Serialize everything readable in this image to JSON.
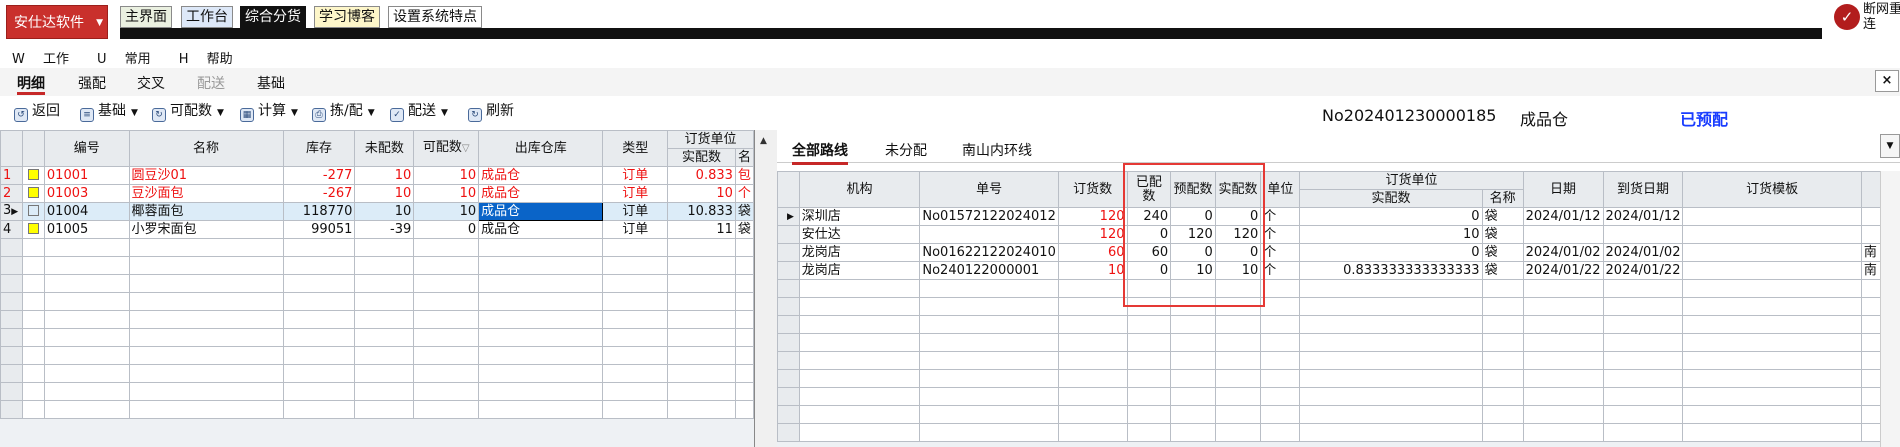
{
  "brand": {
    "label": "安仕达软件"
  },
  "top_tabs": [
    "主界面",
    "工作台",
    "综合分货",
    "学习博客",
    "设置系统特点"
  ],
  "connection": {
    "label_1": "断网重",
    "label_2": "连"
  },
  "menu": [
    {
      "key": "W",
      "label": "工作"
    },
    {
      "key": "U",
      "label": "常用"
    },
    {
      "key": "H",
      "label": "帮助"
    }
  ],
  "sub_tabs": [
    "明细",
    "强配",
    "交叉",
    "配送",
    "基础"
  ],
  "toolbar": {
    "back": "返回",
    "basic": "基础",
    "available": "可配数",
    "calc": "计算",
    "pick": "拣/配",
    "deliver": "配送",
    "refresh": "刷新"
  },
  "info": {
    "order_no": "No202401230000185",
    "warehouse": "成品仓",
    "status": "已预配"
  },
  "colors": {
    "brand": "#c9302c",
    "status": "#1a3dff",
    "highlight": "#e53935",
    "negative": "#e11111"
  },
  "left_table": {
    "headers": [
      "编号",
      "名称",
      "库存",
      "未配数",
      "可配数",
      "出库仓库",
      "类型",
      "订货单位",
      "实配数",
      "名"
    ],
    "rows": [
      {
        "idx": "1",
        "checked": true,
        "code": "01001",
        "name": "圆豆沙01",
        "stock": "-277",
        "unalloc": "10",
        "avail": "10",
        "wh": "成品仓",
        "type": "订单",
        "actual": "0.833",
        "unit": "包",
        "red": true,
        "selected": false
      },
      {
        "idx": "2",
        "checked": true,
        "code": "01003",
        "name": "豆沙面包",
        "stock": "-267",
        "unalloc": "10",
        "avail": "10",
        "wh": "成品仓",
        "type": "订单",
        "actual": "10",
        "unit": "个",
        "red": true,
        "selected": false
      },
      {
        "idx": "3",
        "checked": false,
        "code": "01004",
        "name": "椰蓉面包",
        "stock": "118770",
        "unalloc": "10",
        "avail": "10",
        "wh": "成品仓",
        "type": "订单",
        "actual": "10.833",
        "unit": "袋",
        "red": false,
        "selected": true
      },
      {
        "idx": "4",
        "checked": true,
        "code": "01005",
        "name": "小罗宋面包",
        "stock": "99051",
        "unalloc": "-39",
        "avail": "0",
        "wh": "成品仓",
        "type": "订单",
        "actual": "11",
        "unit": "袋",
        "red": false,
        "selected": false
      }
    ]
  },
  "right_tabs": [
    "全部路线",
    "未分配",
    "南山内环线"
  ],
  "right_table": {
    "headers": {
      "org": "机构",
      "order": "单号",
      "qty": "订货数",
      "alloc": "已配数",
      "prealloc": "预配数",
      "actual": "实配数",
      "unit": "单位",
      "order_unit": "订货单位",
      "actual2": "实配数",
      "name": "名称",
      "date": "日期",
      "arrive": "到货日期",
      "template": "订货模板"
    },
    "rows": [
      {
        "org": "深圳店",
        "order": "No01572122024012",
        "qty": "120",
        "alloc": "240",
        "pre": "0",
        "act": "0",
        "unit": "个",
        "actual2": "0",
        "name": "袋",
        "date": "2024/01/12",
        "arrive": "2024/01/12",
        "tpl": "",
        "current": true
      },
      {
        "org": "安仕达",
        "order": "",
        "qty": "120",
        "alloc": "0",
        "pre": "120",
        "act": "120",
        "unit": "个",
        "actual2": "10",
        "name": "袋",
        "date": "",
        "arrive": "",
        "tpl": "",
        "current": false
      },
      {
        "org": "龙岗店",
        "order": "No01622122024010",
        "qty": "60",
        "alloc": "60",
        "pre": "0",
        "act": "0",
        "unit": "个",
        "actual2": "0",
        "name": "袋",
        "date": "2024/01/02",
        "arrive": "2024/01/02",
        "tpl": "南",
        "current": false
      },
      {
        "org": "龙岗店",
        "order": "No240122000001",
        "qty": "10",
        "alloc": "0",
        "pre": "10",
        "act": "10",
        "unit": "个",
        "actual2": "0.833333333333333",
        "name": "袋",
        "date": "2024/01/22",
        "arrive": "2024/01/22",
        "tpl": "南",
        "current": false
      }
    ]
  }
}
